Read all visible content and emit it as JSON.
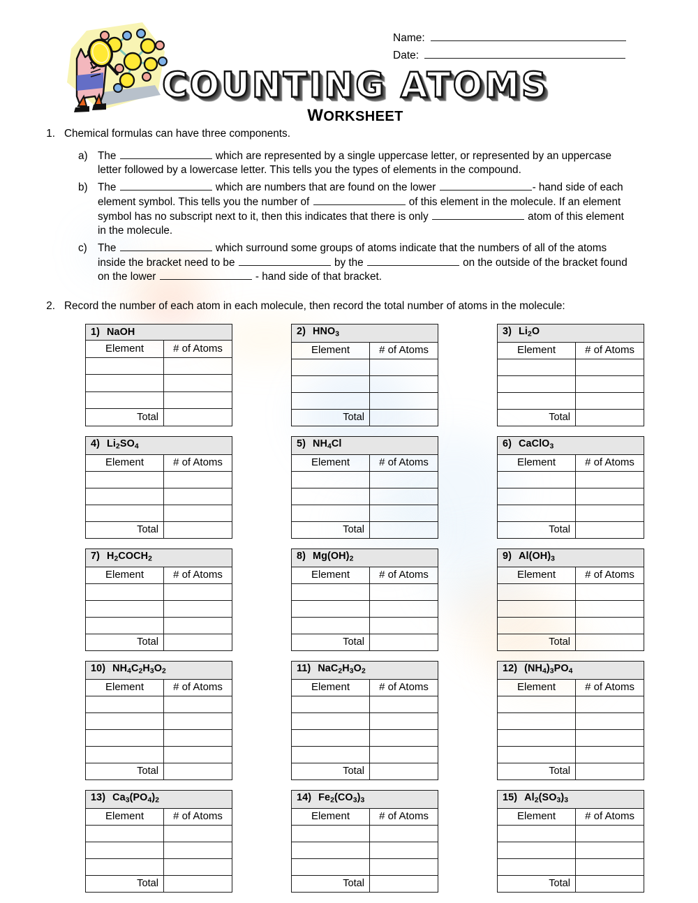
{
  "header": {
    "name_label": "Name:",
    "date_label": "Date:",
    "title": "COUNTING ATOMS",
    "subtitle_cap": "W",
    "subtitle_rest": "ORKSHEET",
    "clipart_name": "scientist-with-magnifying-glass-and-molecule"
  },
  "questions": [
    {
      "number": "1.",
      "stem": "Chemical formulas can have three components.",
      "parts": [
        {
          "label": "a)",
          "segments": [
            {
              "type": "text",
              "value": "The "
            },
            {
              "type": "blank"
            },
            {
              "type": "text",
              "value": " which are represented by a single uppercase letter, or represented by an uppercase letter followed by a lowercase letter.  This tells you the types of elements in the compound."
            }
          ]
        },
        {
          "label": "b)",
          "segments": [
            {
              "type": "text",
              "value": "The "
            },
            {
              "type": "blank"
            },
            {
              "type": "text",
              "value": " which are numbers that are found on the lower "
            },
            {
              "type": "blank"
            },
            {
              "type": "text",
              "value": "- hand side of each element symbol.  This tells you the number of "
            },
            {
              "type": "blank"
            },
            {
              "type": "text",
              "value": " of this element in the molecule.  If an element symbol has no subscript next to it, then this indicates that there is only "
            },
            {
              "type": "blank"
            },
            {
              "type": "text",
              "value": " atom of this element in the molecule."
            }
          ]
        },
        {
          "label": "c)",
          "segments": [
            {
              "type": "text",
              "value": "The "
            },
            {
              "type": "blank"
            },
            {
              "type": "text",
              "value": " which surround some groups of atoms indicate that the numbers of all of the atoms inside the bracket need to be "
            },
            {
              "type": "blank"
            },
            {
              "type": "text",
              "value": " by the "
            },
            {
              "type": "blank"
            },
            {
              "type": "text",
              "value": " on the outside of the bracket found on the lower "
            },
            {
              "type": "blank"
            },
            {
              "type": "text",
              "value": " - hand side of that bracket."
            }
          ]
        }
      ]
    },
    {
      "number": "2.",
      "stem": "Record the number of each atom in each molecule, then record the total number of atoms in the molecule:",
      "parts": []
    }
  ],
  "table_headers": {
    "element": "Element",
    "num_atoms": "# of Atoms",
    "total": "Total"
  },
  "molecule_tables": [
    [
      {
        "num": "1)",
        "formula_html": "NaOH",
        "blank_rows": 3
      },
      {
        "num": "2)",
        "formula_html": "HNO<sub>3</sub>",
        "blank_rows": 3
      },
      {
        "num": "3)",
        "formula_html": "Li<sub>2</sub>O",
        "blank_rows": 3
      }
    ],
    [
      {
        "num": "4)",
        "formula_html": "Li<sub>2</sub>SO<sub>4</sub>",
        "blank_rows": 3
      },
      {
        "num": "5)",
        "formula_html": "NH<sub>4</sub>Cl",
        "blank_rows": 3
      },
      {
        "num": "6)",
        "formula_html": "CaClO<sub>3</sub>",
        "blank_rows": 3
      }
    ],
    [
      {
        "num": "7)",
        "formula_html": "H<sub>2</sub>COCH<sub>2</sub>",
        "blank_rows": 3
      },
      {
        "num": "8)",
        "formula_html": "Mg(OH)<sub>2</sub>",
        "blank_rows": 3
      },
      {
        "num": "9)",
        "formula_html": "Al(OH)<sub>3</sub>",
        "blank_rows": 3
      }
    ],
    [
      {
        "num": "10)",
        "formula_html": "NH<sub>4</sub>C<sub>2</sub>H<sub>3</sub>O<sub>2</sub>",
        "blank_rows": 4
      },
      {
        "num": "11)",
        "formula_html": "NaC<sub>2</sub>H<sub>3</sub>O<sub>2</sub>",
        "blank_rows": 4
      },
      {
        "num": "12)",
        "formula_html": "(NH<sub>4</sub>)<sub>3</sub>PO<sub>4</sub>",
        "blank_rows": 4
      }
    ],
    [
      {
        "num": "13)",
        "formula_html": "Ca<sub>3</sub>(PO<sub>4</sub>)<sub>2</sub>",
        "blank_rows": 3
      },
      {
        "num": "14)",
        "formula_html": "Fe<sub>2</sub>(CO<sub>3</sub>)<sub>3</sub>",
        "blank_rows": 3
      },
      {
        "num": "15)",
        "formula_html": "Al<sub>2</sub>(SO<sub>3</sub>)<sub>3</sub>",
        "blank_rows": 3
      }
    ]
  ],
  "colors": {
    "header_fill": "#e6e6e6",
    "rule": "#1a1a1a",
    "clipart_yellow": "#f7f3b0",
    "clipart_pink": "#f3b7bd",
    "clipart_blue": "#4a62c8",
    "clipart_atom_yellow": "#ffeb33",
    "clipart_atom_blue": "#7fb2e8",
    "clipart_atom_pink": "#f2a9a0",
    "clipart_shadow": "#b9c2cc"
  }
}
